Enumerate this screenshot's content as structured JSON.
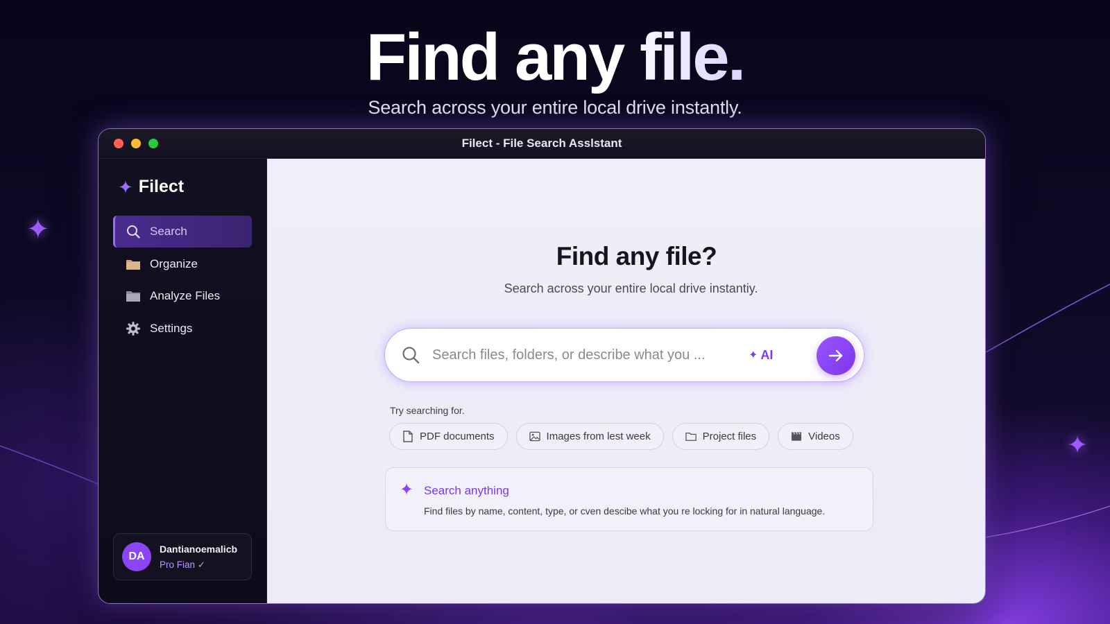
{
  "hero": {
    "title": "Find any file.",
    "subtitle": "Search across your entire local drive instantly."
  },
  "window": {
    "title": "Filect - File Search Asslstant"
  },
  "sidebar": {
    "brand": "Filect",
    "items": [
      {
        "label": "Search",
        "icon": "search-icon",
        "active": true
      },
      {
        "label": "Organize",
        "icon": "folder-icon",
        "active": false
      },
      {
        "label": "Analyze Files",
        "icon": "folder-icon",
        "active": false
      },
      {
        "label": "Settings",
        "icon": "gear-icon",
        "active": false
      }
    ],
    "user": {
      "initials": "DA",
      "name": "Dantianoemalicb",
      "plan": "Pro Fian ✓"
    }
  },
  "main": {
    "title": "Find any file?",
    "subtitle": "Search across your entire local drive instantiy.",
    "search": {
      "placeholder": "Search files, folders, or describe what you ...",
      "value": "",
      "ai_label": "AI"
    },
    "try_label": "Try searching for.",
    "suggestions": [
      {
        "label": "PDF documents",
        "icon": "document-icon"
      },
      {
        "label": "Images from lest week",
        "icon": "image-icon"
      },
      {
        "label": "Project files",
        "icon": "folder-icon"
      },
      {
        "label": "Videos",
        "icon": "video-icon"
      }
    ],
    "info": {
      "title": "Search anything",
      "text": "Find files by name, content, type, or cven descibe what you re locking for in natural language."
    }
  },
  "colors": {
    "accent": "#8b45f5",
    "accent_dark": "#7b35ea",
    "sidebar_bg": "#121020",
    "main_bg": "#efeefa"
  }
}
